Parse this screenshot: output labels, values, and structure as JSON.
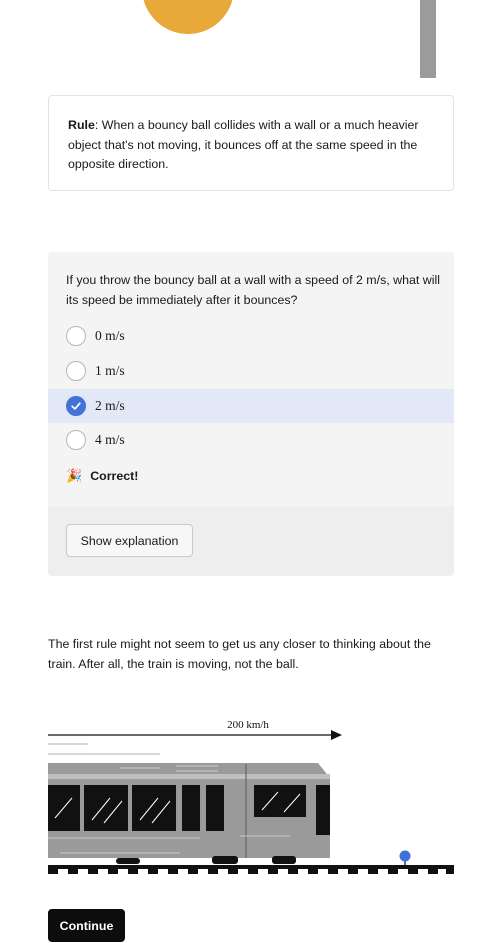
{
  "rule": {
    "label": "Rule",
    "text": ": When a bouncy ball collides with a wall or a much heavier object that's not moving, it bounces off at the same speed in the opposite direction."
  },
  "question": {
    "text": "If you throw the bouncy ball at a wall with a speed of 2 m/s, what will its speed be immediately after it bounces?",
    "options": [
      {
        "label": "0 m/s",
        "selected": false
      },
      {
        "label": "1 m/s",
        "selected": false
      },
      {
        "label": "2 m/s",
        "selected": true
      },
      {
        "label": "4 m/s",
        "selected": false
      }
    ],
    "feedback": "Correct!",
    "explanation_button": "Show explanation"
  },
  "paragraph": "The first rule might not seem to get us any closer to thinking about the train. After all, the train is moving, not the ball.",
  "diagram": {
    "speed_label": "200 km/h"
  },
  "footer": {
    "continue_label": "Continue"
  },
  "colors": {
    "ball_top": "#e8a93a",
    "ball_small": "#3f6fd8",
    "selected_bg": "#e3e8f6",
    "check": "#4373d8"
  }
}
